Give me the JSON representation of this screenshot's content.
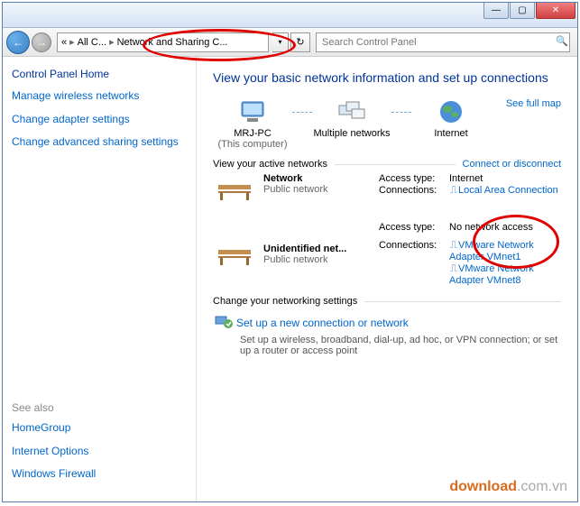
{
  "window": {
    "min_tip": "Minimize",
    "max_tip": "Maximize",
    "close_tip": "Close"
  },
  "nav": {
    "breadcrumb_root": "«",
    "breadcrumb_1": "All C...",
    "breadcrumb_2": "Network and Sharing C...",
    "search_placeholder": "Search Control Panel"
  },
  "sidebar": {
    "home": "Control Panel Home",
    "links": [
      "Manage wireless networks",
      "Change adapter settings",
      "Change advanced sharing settings"
    ],
    "see_also_hdr": "See also",
    "see_also": [
      "HomeGroup",
      "Internet Options",
      "Windows Firewall"
    ]
  },
  "main": {
    "title": "View your basic network information and set up connections",
    "map": {
      "pc": "MRJ-PC",
      "pc_sub": "(This computer)",
      "multi": "Multiple networks",
      "internet": "Internet",
      "see_full": "See full map"
    },
    "active_hdr": "View your active networks",
    "connect_link": "Connect or disconnect",
    "networks": [
      {
        "name": "Network",
        "type": "Public network",
        "access_lbl": "Access type:",
        "access_val": "Internet",
        "conn_lbl": "Connections:",
        "conn_val": "Local Area Connection"
      },
      {
        "name": "Unidentified net...",
        "type": "Public network",
        "access_lbl": "Access type:",
        "access_val": "No network access",
        "conn_lbl": "Connections:",
        "conns": [
          "VMware Network Adapter VMnet1",
          "VMware Network Adapter VMnet8"
        ]
      }
    ],
    "change_hdr": "Change your networking settings",
    "setup_link": "Set up a new connection or network",
    "setup_desc": "Set up a wireless, broadband, dial-up, ad hoc, or VPN connection; or set up a router or access point"
  },
  "watermark": {
    "brand": "download",
    "suffix": ".com.vn"
  }
}
